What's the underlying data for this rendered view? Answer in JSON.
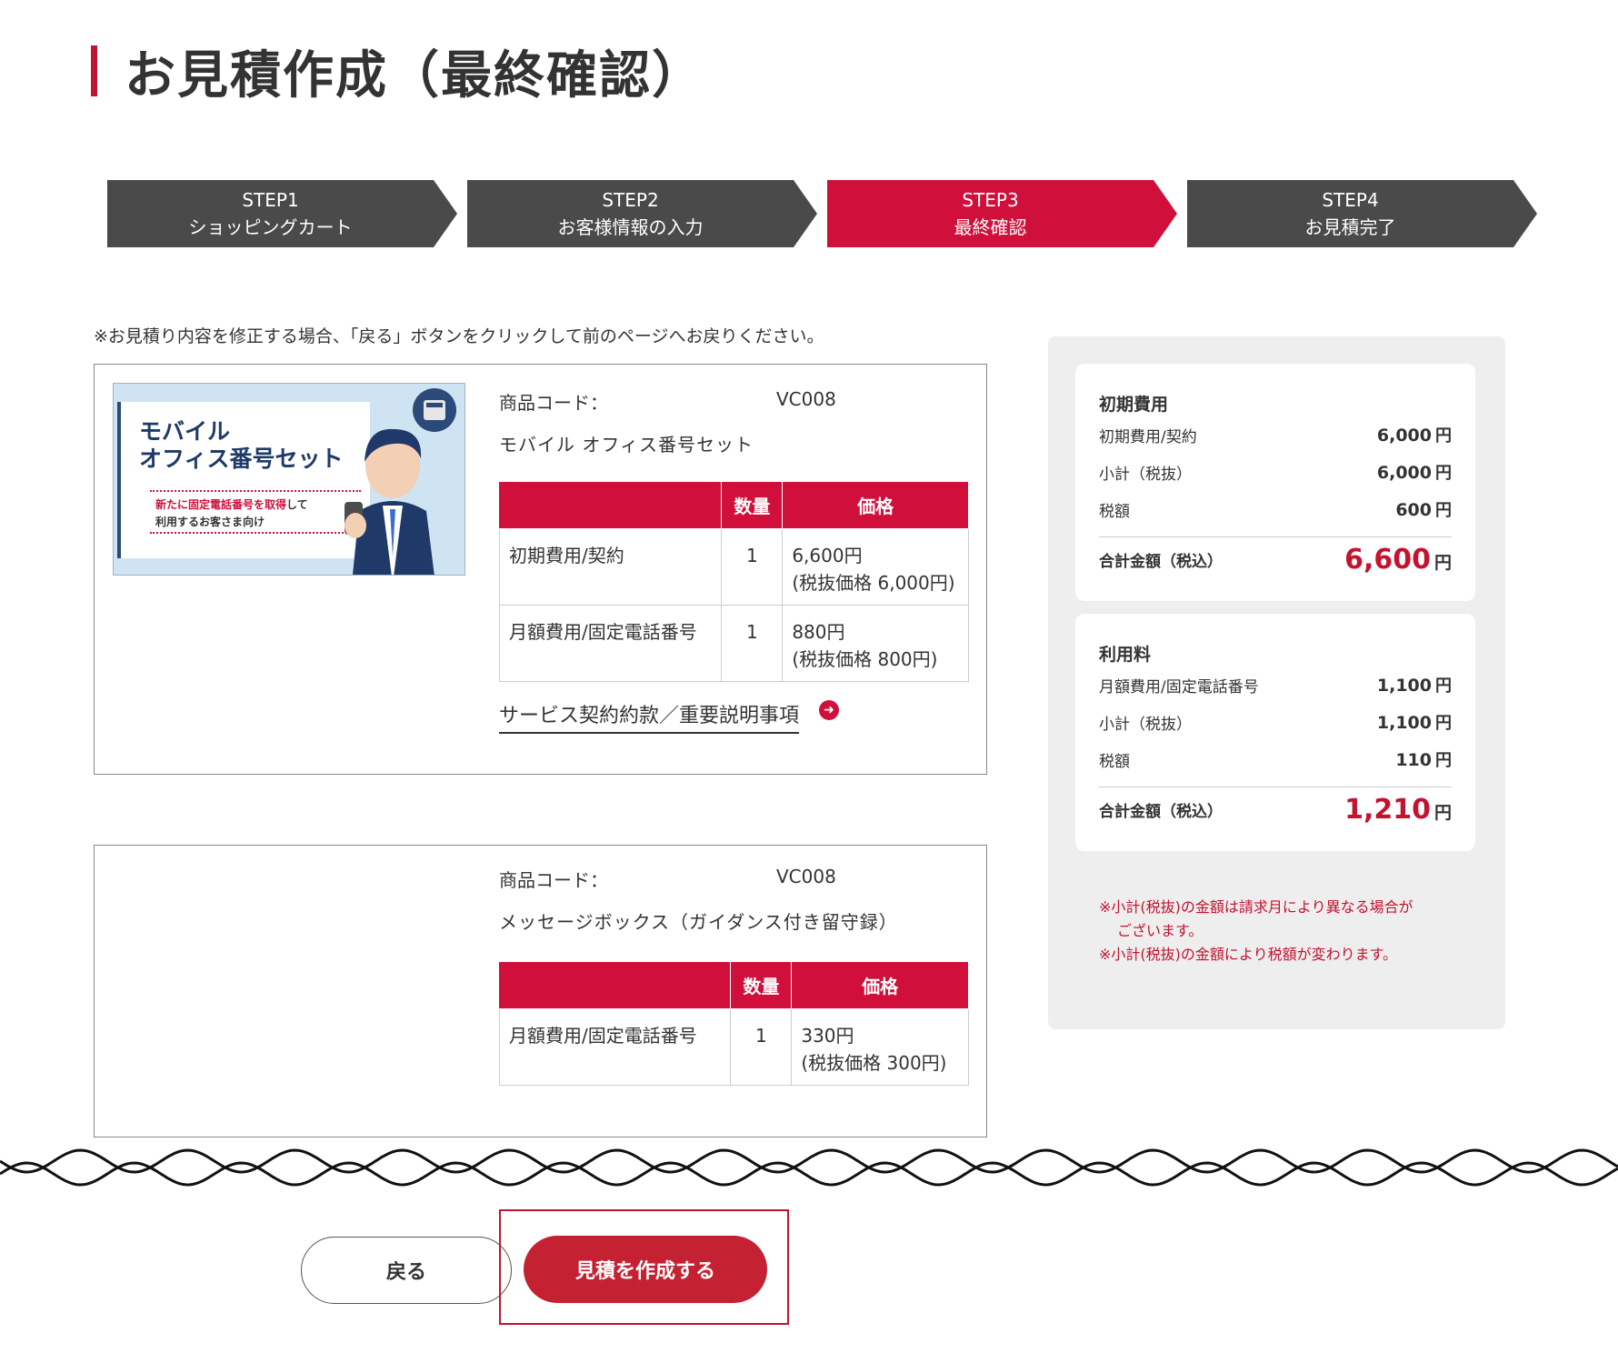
{
  "page": {
    "title": "お見積作成（最終確認）"
  },
  "steps": [
    {
      "num": "STEP1",
      "label": "ショッピングカート",
      "active": false
    },
    {
      "num": "STEP2",
      "label": "お客様情報の入力",
      "active": false
    },
    {
      "num": "STEP3",
      "label": "最終確認",
      "active": true
    },
    {
      "num": "STEP4",
      "label": "お見積完了",
      "active": false
    }
  ],
  "notice": "※お見積り内容を修正する場合、「戻る」ボタンをクリックして前のページへお戻りください。",
  "products": [
    {
      "code_label": "商品コード：",
      "code": "VC008",
      "name": "モバイル オフィス番号セット",
      "image": {
        "title_line1": "モバイル",
        "title_line2": "オフィス番号セット",
        "sub_line1_red": "新たに固定電話番号を取得",
        "sub_line1_rest": "して",
        "sub_line2": "利用するお客さま向け"
      },
      "table": {
        "headers": [
          "",
          "数量",
          "価格"
        ],
        "rows": [
          {
            "name": "初期費用/契約",
            "qty": "1",
            "price": "6,600円",
            "price_ex": "(税抜価格 6,000円)"
          },
          {
            "name": "月額費用/固定電話番号",
            "qty": "1",
            "price": "880円",
            "price_ex": "(税抜価格 800円)"
          }
        ]
      },
      "terms_link": "サービス契約約款／重要説明事項"
    },
    {
      "code_label": "商品コード：",
      "code": "VC008",
      "name": "メッセージボックス（ガイダンス付き留守録）",
      "table": {
        "headers": [
          "",
          "数量",
          "価格"
        ],
        "rows": [
          {
            "name": "月額費用/固定電話番号",
            "qty": "1",
            "price": "330円",
            "price_ex": "(税抜価格 300円)"
          }
        ]
      }
    }
  ],
  "summary": {
    "initial": {
      "title": "初期費用",
      "rows": [
        {
          "label": "初期費用/契約",
          "value": "6,000",
          "unit": "円"
        },
        {
          "label": "小計（税抜）",
          "value": "6,000",
          "unit": "円"
        },
        {
          "label": "税額",
          "value": "600",
          "unit": "円"
        }
      ],
      "total_label": "合計金額（税込）",
      "total_value": "6,600",
      "total_unit": "円"
    },
    "usage": {
      "title": "利用料",
      "rows": [
        {
          "label": "月額費用/固定電話番号",
          "value": "1,100",
          "unit": "円"
        },
        {
          "label": "小計（税抜）",
          "value": "1,100",
          "unit": "円"
        },
        {
          "label": "税額",
          "value": "110",
          "unit": "円"
        }
      ],
      "total_label": "合計金額（税込）",
      "total_value": "1,210",
      "total_unit": "円"
    },
    "note_line1": "※小計(税抜)の金額は請求月により異なる場合が",
    "note_line1b": "ございます。",
    "note_line2": "※小計(税抜)の金額により税額が変わります。"
  },
  "buttons": {
    "back": "戻る",
    "create": "見積を作成する"
  },
  "colors": {
    "accent": "#d0103a",
    "step_inactive": "#4a4a4a",
    "summary_bg": "#eeeeee",
    "create_button": "#c42233"
  }
}
